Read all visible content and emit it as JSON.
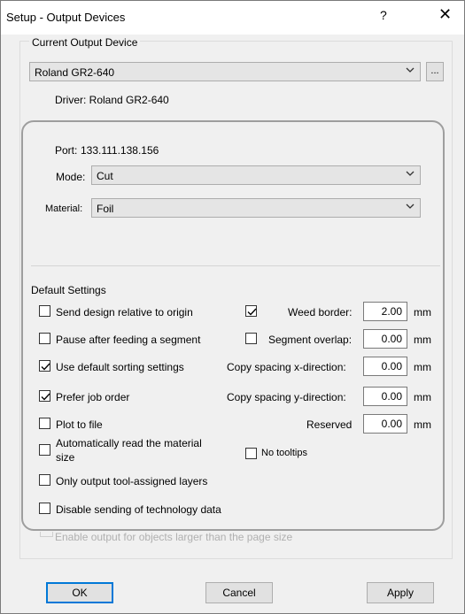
{
  "window": {
    "title": "Setup - Output Devices",
    "help": "?",
    "close": "✕"
  },
  "current_device": {
    "group_label": "Current Output Device",
    "device_value": "Roland GR2-640",
    "more_button": "...",
    "driver_text": "Driver: Roland GR2-640"
  },
  "port": {
    "label": "Port:",
    "value": "133.111.138.156"
  },
  "mode": {
    "label": "Mode:",
    "value": "Cut"
  },
  "material": {
    "label": "Material:",
    "value": "Foil"
  },
  "default_settings": {
    "label": "Default Settings",
    "checkboxes": [
      {
        "label": "Send design relative to origin",
        "checked": false
      },
      {
        "label": "Pause after feeding a segment",
        "checked": false
      },
      {
        "label": "Use default sorting settings",
        "checked": true
      },
      {
        "label": "Prefer job order",
        "checked": true
      },
      {
        "label": "Plot to file",
        "checked": false
      },
      {
        "label": "Automatically read the material",
        "label2": "size",
        "checked": false
      },
      {
        "label": "Only output tool-assigned layers",
        "checked": false
      },
      {
        "label": "Disable sending of technology data",
        "checked": false
      }
    ],
    "right_fields": [
      {
        "label": "Weed border:",
        "value": "2.00",
        "unit": "mm",
        "has_checkbox": true,
        "checked": true
      },
      {
        "label": "Segment overlap:",
        "value": "0.00",
        "unit": "mm",
        "has_checkbox": true,
        "checked": false
      },
      {
        "label": "Copy spacing x-direction:",
        "value": "0.00",
        "unit": "mm"
      },
      {
        "label": "Copy spacing y-direction:",
        "value": "0.00",
        "unit": "mm"
      },
      {
        "label": "Reserved",
        "value": "0.00",
        "unit": "mm"
      }
    ],
    "no_tooltips": {
      "label": "No tooltips",
      "checked": false
    }
  },
  "obscured_option": "Enable output for objects larger than the page size",
  "buttons": {
    "ok": "OK",
    "cancel": "Cancel",
    "apply": "Apply"
  }
}
